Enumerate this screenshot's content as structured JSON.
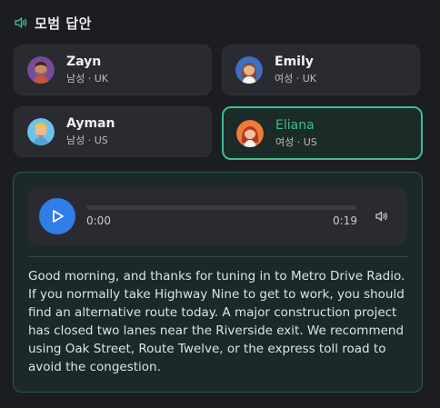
{
  "header": {
    "title": "모범 답안"
  },
  "voices": [
    {
      "name": "Zayn",
      "meta": "남성 · UK",
      "selected": false
    },
    {
      "name": "Emily",
      "meta": "여성 · UK",
      "selected": false
    },
    {
      "name": "Ayman",
      "meta": "남성 · US",
      "selected": false
    },
    {
      "name": "Eliana",
      "meta": "여성 · US",
      "selected": true
    }
  ],
  "player": {
    "current_time": "0:00",
    "total_time": "0:19",
    "progress": 0
  },
  "transcript": "Good morning, and thanks for tuning in to Metro Drive Radio. If you normally take Highway Nine to get to work, you should find an alternative route today. A major construction project has closed two lanes near the Riverside exit. We recommend using Oak Street, Route Twelve, or the express toll road to avoid the congestion.",
  "colors": {
    "accent": "#3dbd8a",
    "play": "#2f7de8"
  }
}
